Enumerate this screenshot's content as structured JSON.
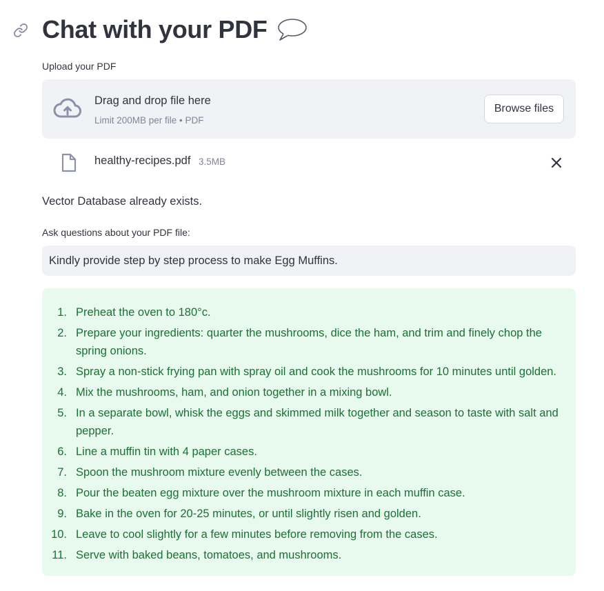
{
  "header": {
    "title": "Chat with your PDF"
  },
  "uploader": {
    "label": "Upload your PDF",
    "dropzone_title": "Drag and drop file here",
    "dropzone_limit": "Limit 200MB per file • PDF",
    "browse_label": "Browse files"
  },
  "uploaded_file": {
    "name": "healthy-recipes.pdf",
    "size": "3.5MB"
  },
  "status": {
    "message": "Vector Database already exists."
  },
  "question": {
    "label": "Ask questions about your PDF file:",
    "value": "Kindly provide step by step process to make Egg Muffins."
  },
  "answer": {
    "steps": [
      {
        "num": "1.",
        "text": "Preheat the oven to 180°c."
      },
      {
        "num": "2.",
        "text": "Prepare your ingredients: quarter the mushrooms, dice the ham, and trim and finely chop the spring onions."
      },
      {
        "num": "3.",
        "text": "Spray a non-stick frying pan with spray oil and cook the mushrooms for 10 minutes until golden."
      },
      {
        "num": "4.",
        "text": "Mix the mushrooms, ham, and onion together in a mixing bowl."
      },
      {
        "num": "5.",
        "text": "In a separate bowl, whisk the eggs and skimmed milk together and season to taste with salt and pepper."
      },
      {
        "num": "6.",
        "text": "Line a muffin tin with 4 paper cases."
      },
      {
        "num": "7.",
        "text": "Spoon the mushroom mixture evenly between the cases."
      },
      {
        "num": "8.",
        "text": "Pour the beaten egg mixture over the mushroom mixture in each muffin case."
      },
      {
        "num": "9.",
        "text": "Bake in the oven for 20-25 minutes, or until slightly risen and golden."
      },
      {
        "num": "10.",
        "text": "Leave to cool slightly for a few minutes before removing from the cases."
      },
      {
        "num": "11.",
        "text": "Serve with baked beans, tomatoes, and mushrooms."
      }
    ]
  },
  "icons": {
    "header_anchor": "link-icon",
    "title_emoji": "speech-balloon-icon",
    "upload": "cloud-upload-icon",
    "file": "file-icon",
    "remove": "close-icon"
  },
  "colors": {
    "text": "#31333f",
    "muted": "#808495",
    "input_bg": "#f0f2f6",
    "success_bg": "#e8f9ee",
    "success_text": "#177233"
  }
}
